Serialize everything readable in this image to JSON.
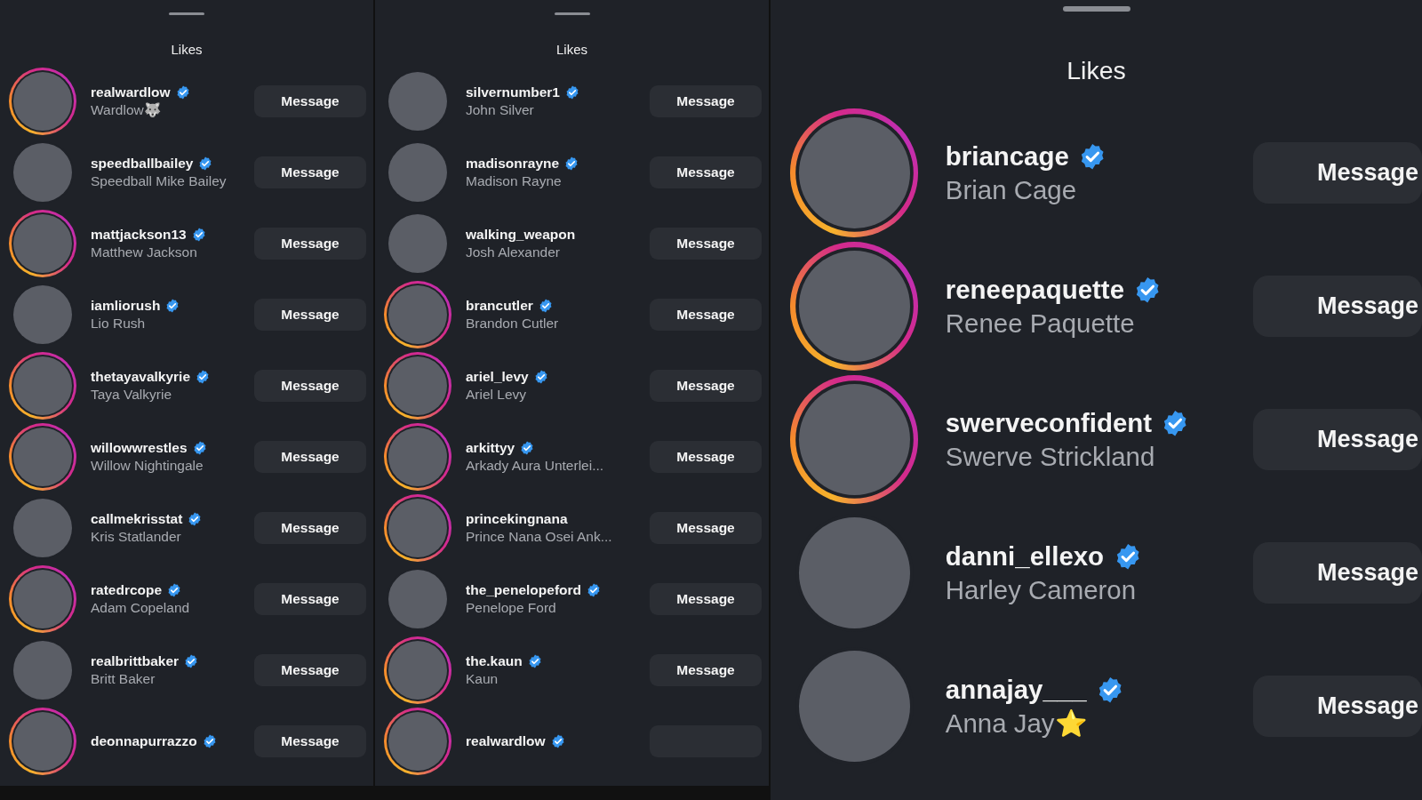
{
  "panels": [
    {
      "kind": "compact",
      "title": "Likes",
      "users": [
        {
          "username": "realwardlow",
          "full_name": "Wardlow🐺",
          "verified": true,
          "story_ring": true,
          "button": "Message"
        },
        {
          "username": "speedballbailey",
          "full_name": "Speedball Mike Bailey",
          "verified": true,
          "story_ring": false,
          "button": "Message"
        },
        {
          "username": "mattjackson13",
          "full_name": "Matthew Jackson",
          "verified": true,
          "story_ring": true,
          "button": "Message"
        },
        {
          "username": "iamliorush",
          "full_name": "Lio Rush",
          "verified": true,
          "story_ring": false,
          "button": "Message"
        },
        {
          "username": "thetayavalkyrie",
          "full_name": "Taya Valkyrie",
          "verified": true,
          "story_ring": true,
          "button": "Message"
        },
        {
          "username": "willowwrestles",
          "full_name": "Willow Nightingale",
          "verified": true,
          "story_ring": true,
          "button": "Message"
        },
        {
          "username": "callmekrisstat",
          "full_name": "Kris Statlander",
          "verified": true,
          "story_ring": false,
          "button": "Message"
        },
        {
          "username": "ratedrcope",
          "full_name": "Adam Copeland",
          "verified": true,
          "story_ring": true,
          "button": "Message"
        },
        {
          "username": "realbrittbaker",
          "full_name": "Britt Baker",
          "verified": true,
          "story_ring": false,
          "button": "Message"
        },
        {
          "username": "deonnapurrazzo",
          "verified": true,
          "story_ring": true,
          "button": "Message"
        }
      ]
    },
    {
      "kind": "compact",
      "title": "Likes",
      "users": [
        {
          "username": "silvernumber1",
          "full_name": "John Silver",
          "verified": true,
          "story_ring": false,
          "button": "Message"
        },
        {
          "username": "madisonrayne",
          "full_name": "Madison Rayne",
          "verified": true,
          "story_ring": false,
          "button": "Message"
        },
        {
          "username": "walking_weapon",
          "full_name": "Josh Alexander",
          "verified": false,
          "story_ring": false,
          "button": "Message"
        },
        {
          "username": "brancutler",
          "full_name": "Brandon Cutler",
          "verified": true,
          "story_ring": true,
          "button": "Message"
        },
        {
          "username": "ariel_levy",
          "full_name": "Ariel Levy",
          "verified": true,
          "story_ring": true,
          "button": "Message"
        },
        {
          "username": "arkittyy",
          "full_name": "Arkady Aura Unterlei...",
          "verified": true,
          "story_ring": true,
          "button": "Message"
        },
        {
          "username": "princekingnana",
          "full_name": "Prince Nana Osei Ank...",
          "verified": false,
          "story_ring": true,
          "button": "Message"
        },
        {
          "username": "the_penelopeford",
          "full_name": "Penelope Ford",
          "verified": true,
          "story_ring": false,
          "button": "Message"
        },
        {
          "username": "the.kaun",
          "full_name": "Kaun",
          "verified": true,
          "story_ring": true,
          "button": "Message"
        },
        {
          "username": "realwardlow",
          "verified": true,
          "story_ring": true
        }
      ]
    },
    {
      "kind": "enlarged",
      "title": "Likes",
      "users": [
        {
          "username": "briancage",
          "full_name": "Brian Cage",
          "verified": true,
          "story_ring": true,
          "button": "Message"
        },
        {
          "username": "reneepaquette",
          "full_name": "Renee Paquette",
          "verified": true,
          "story_ring": true,
          "button": "Message"
        },
        {
          "username": "swerveconfident",
          "full_name": "Swerve Strickland",
          "verified": true,
          "story_ring": true,
          "button": "Message"
        },
        {
          "username": "danni_ellexo",
          "full_name": "Harley Cameron",
          "verified": true,
          "story_ring": false,
          "button": "Message"
        },
        {
          "username": "annajay___",
          "full_name": "Anna Jay⭐",
          "verified": true,
          "story_ring": false,
          "button": "Message"
        }
      ]
    }
  ]
}
